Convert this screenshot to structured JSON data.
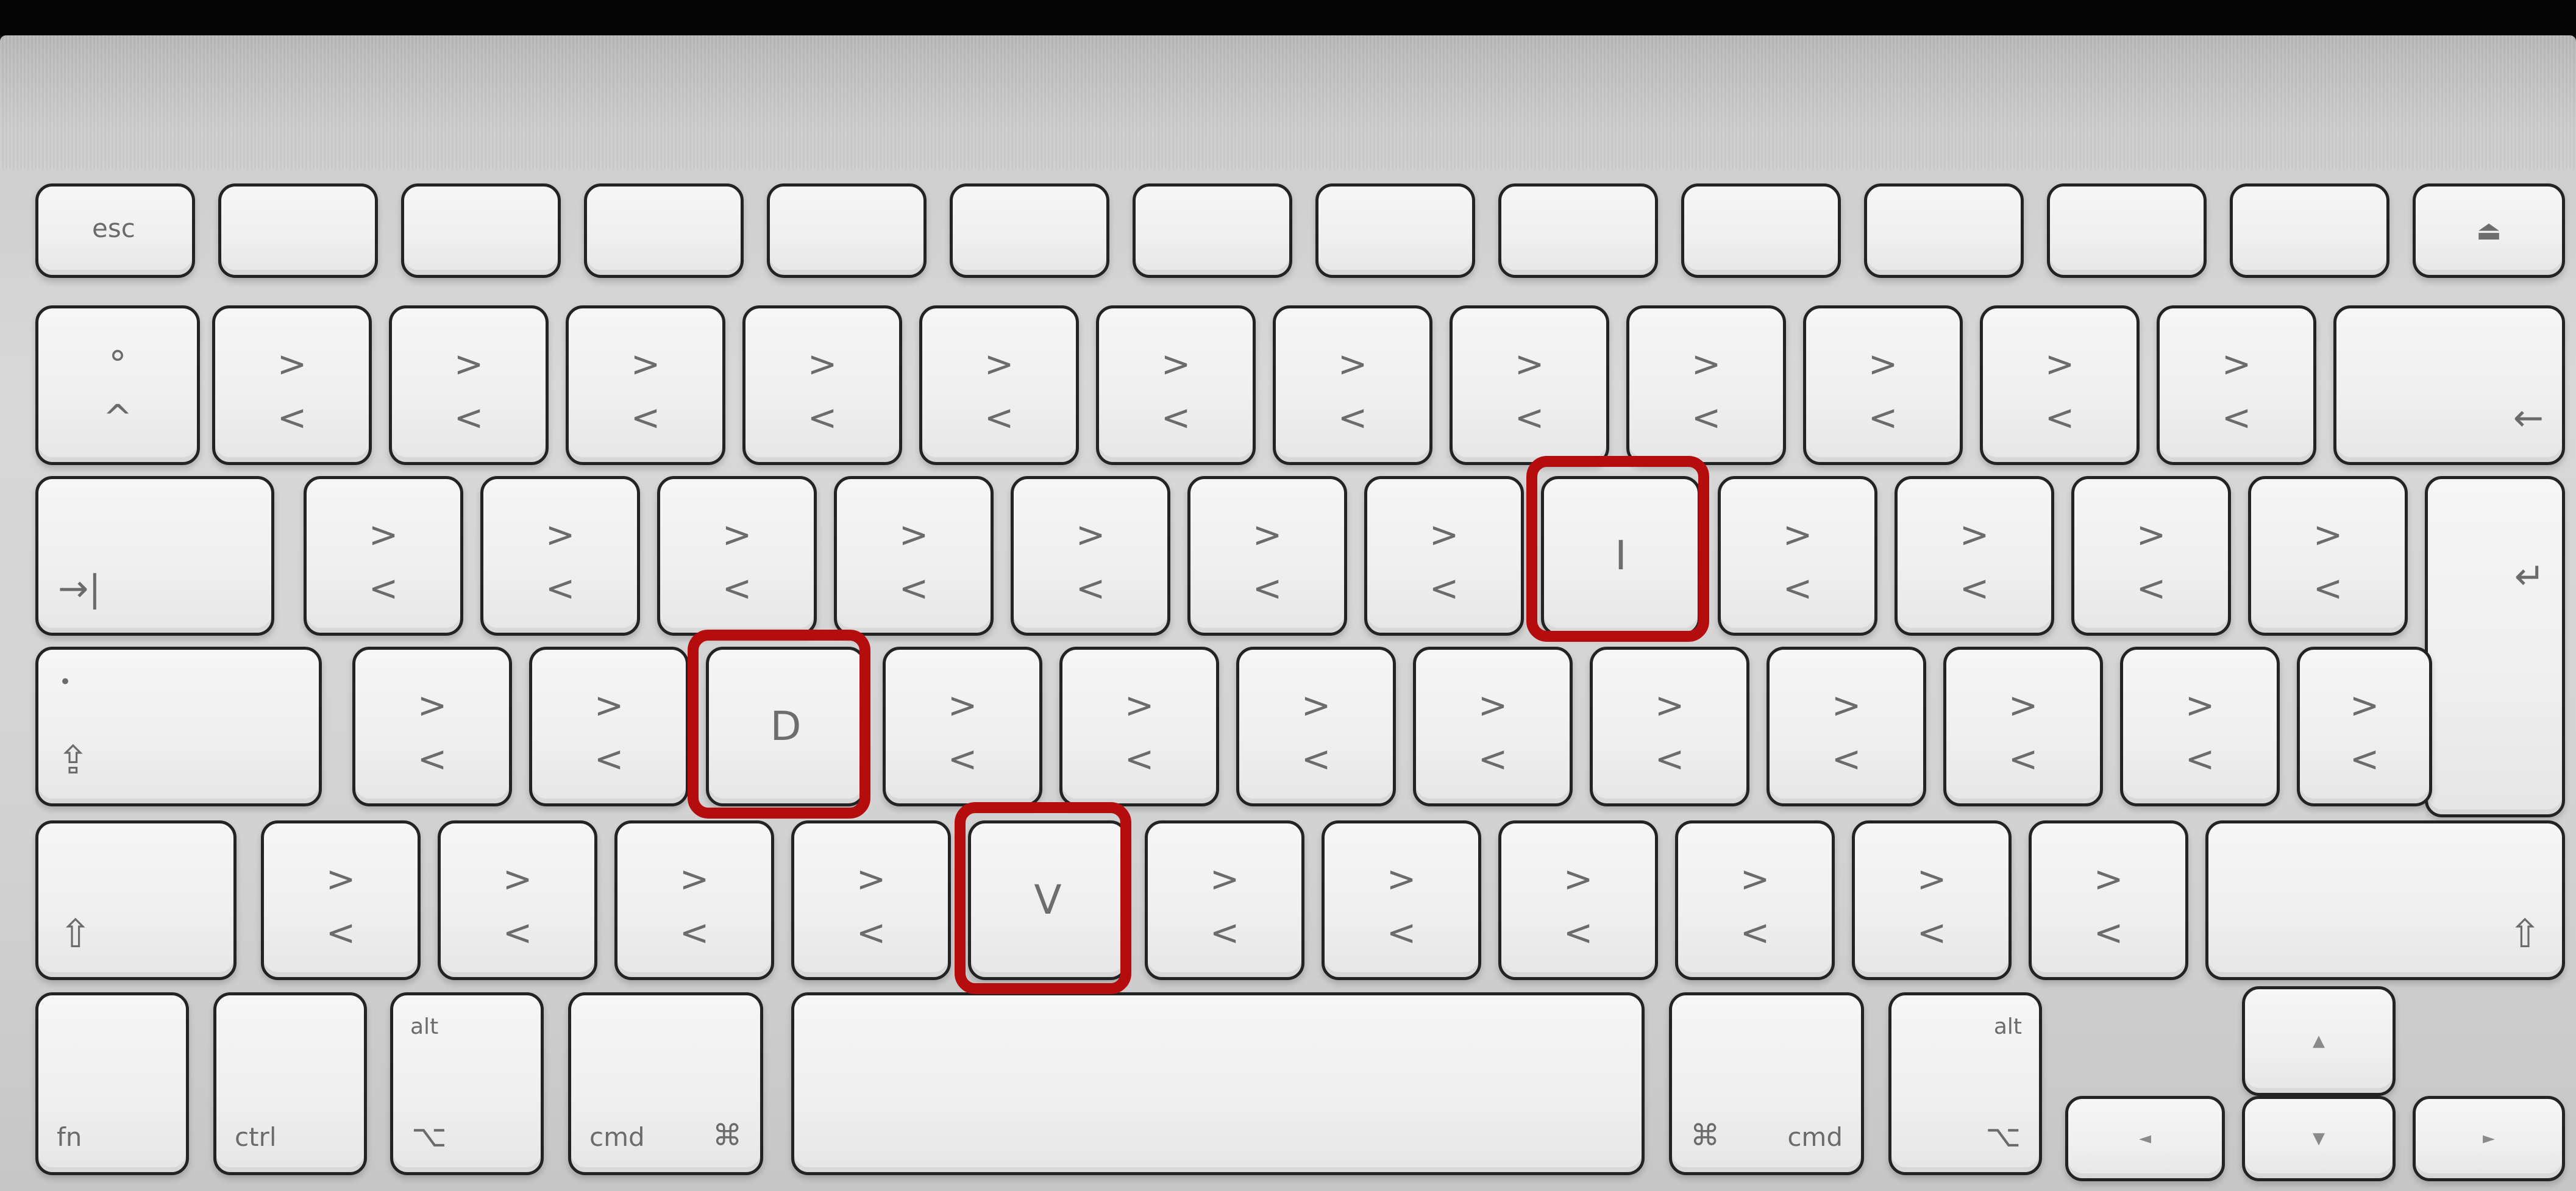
{
  "keyboard": {
    "esc": "esc",
    "eject": "⏏",
    "lt": "<",
    "gt": ">",
    "degree": "°",
    "caret": "^",
    "backspace": "←",
    "tab": "→|",
    "enter": "↵",
    "dot": "•",
    "caps": "⇪",
    "shift": "⇧",
    "fn": "fn",
    "ctrl": "ctrl",
    "alt": "alt",
    "option": "⌥",
    "cmd": "cmd",
    "cmd_symbol": "⌘",
    "arrow_up": "▲",
    "arrow_down": "▼",
    "arrow_left": "◄",
    "arrow_right": "►",
    "letter_i": "I",
    "letter_d": "D",
    "letter_v": "V"
  },
  "highlight_color": "#b50d0d"
}
